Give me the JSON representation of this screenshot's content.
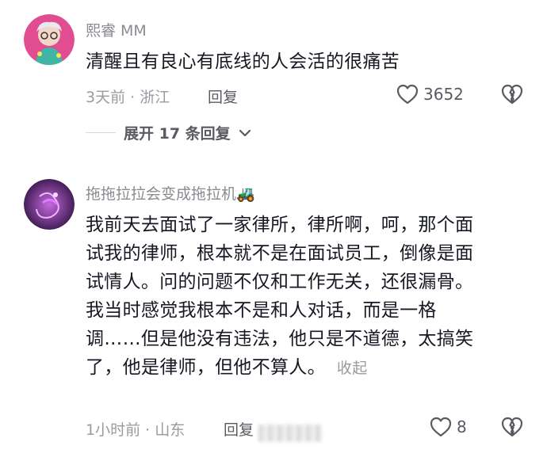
{
  "comments": [
    {
      "username": "熙睿 MM",
      "text": "清醒且有良心有底线的人会活的很痛苦",
      "meta": "3天前 · 浙江",
      "reply_label": "回复",
      "like_count": "3652",
      "expand_label": "展开 17 条回复"
    },
    {
      "username": "拖拖拉拉会变成拖拉机🚜",
      "lines": [
        "我前天去面试了一家律所，律所啊，呵，那个面",
        "试我的律师，根本就不是在面试员工，倒像是面",
        "试情人。问的问题不仅和工作无关，还很漏骨。",
        "我当时感觉我根本不是和人对话，而是一格",
        "调……但是他没有违法，他只是不道德，太搞笑",
        "了，他是律师，但他不算人。"
      ],
      "collapse_label": "收起",
      "meta": "1小时前 · 山东",
      "reply_label": "回复",
      "like_count": "8"
    }
  ],
  "icons": {
    "like": "heart-outline-icon",
    "dislike": "broken-heart-icon",
    "expand": "chevron-down-icon"
  },
  "colors": {
    "text": "#161823",
    "secondary": "#9a9ba1",
    "action": "#5a5b62",
    "avatar1": "#e04e91",
    "avatar2": "#6d2d8f"
  }
}
